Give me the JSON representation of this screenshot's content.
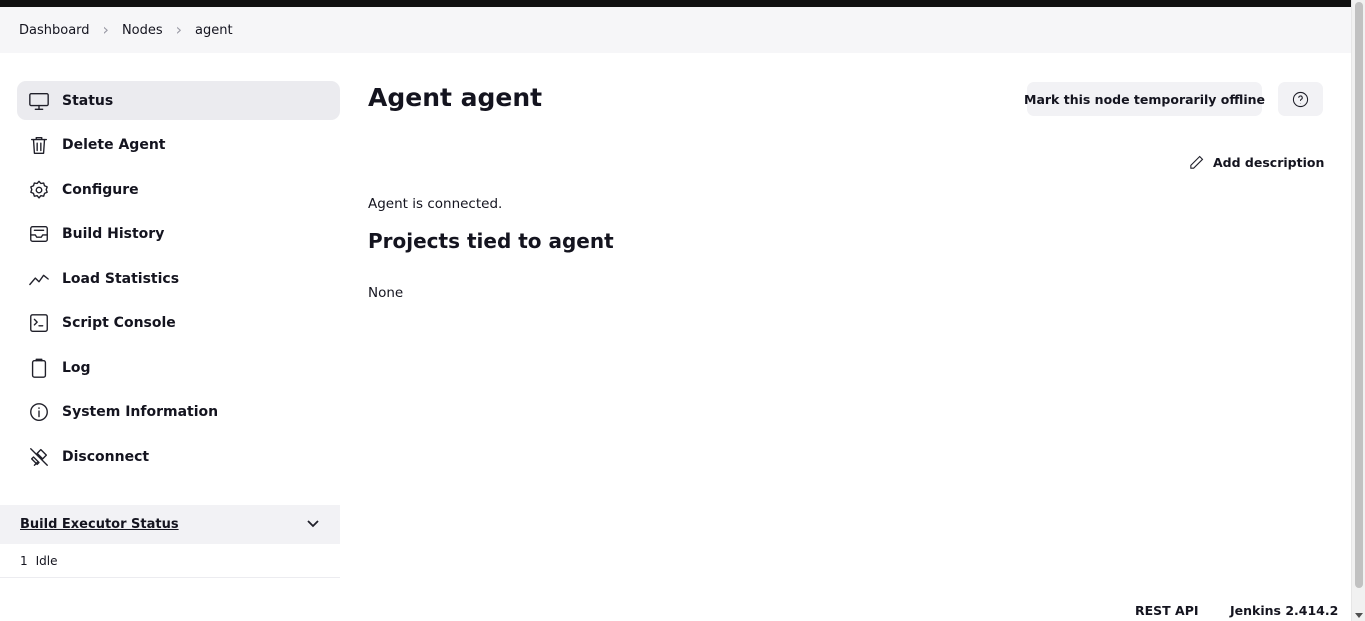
{
  "breadcrumb": {
    "items": [
      "Dashboard",
      "Nodes",
      "agent"
    ]
  },
  "sidebar": {
    "items": [
      {
        "label": "Status",
        "icon": "monitor-icon",
        "active": true
      },
      {
        "label": "Delete Agent",
        "icon": "trash-icon"
      },
      {
        "label": "Configure",
        "icon": "gear-icon"
      },
      {
        "label": "Build History",
        "icon": "inbox-icon"
      },
      {
        "label": "Load Statistics",
        "icon": "trend-line-icon"
      },
      {
        "label": "Script Console",
        "icon": "terminal-icon"
      },
      {
        "label": "Log",
        "icon": "clipboard-icon"
      },
      {
        "label": "System Information",
        "icon": "info-icon"
      },
      {
        "label": "Disconnect",
        "icon": "unplug-icon"
      }
    ]
  },
  "executors": {
    "title": "Build Executor Status",
    "rows": [
      {
        "number": "1",
        "status": "Idle"
      }
    ]
  },
  "main": {
    "title": "Agent agent",
    "offline_button": "Mark this node temporarily offline",
    "add_description": "Add description",
    "connection_status": "Agent is connected.",
    "projects_heading": "Projects tied to agent",
    "projects_value": "None"
  },
  "footer": {
    "rest_api": "REST API",
    "version": "Jenkins 2.414.2"
  }
}
